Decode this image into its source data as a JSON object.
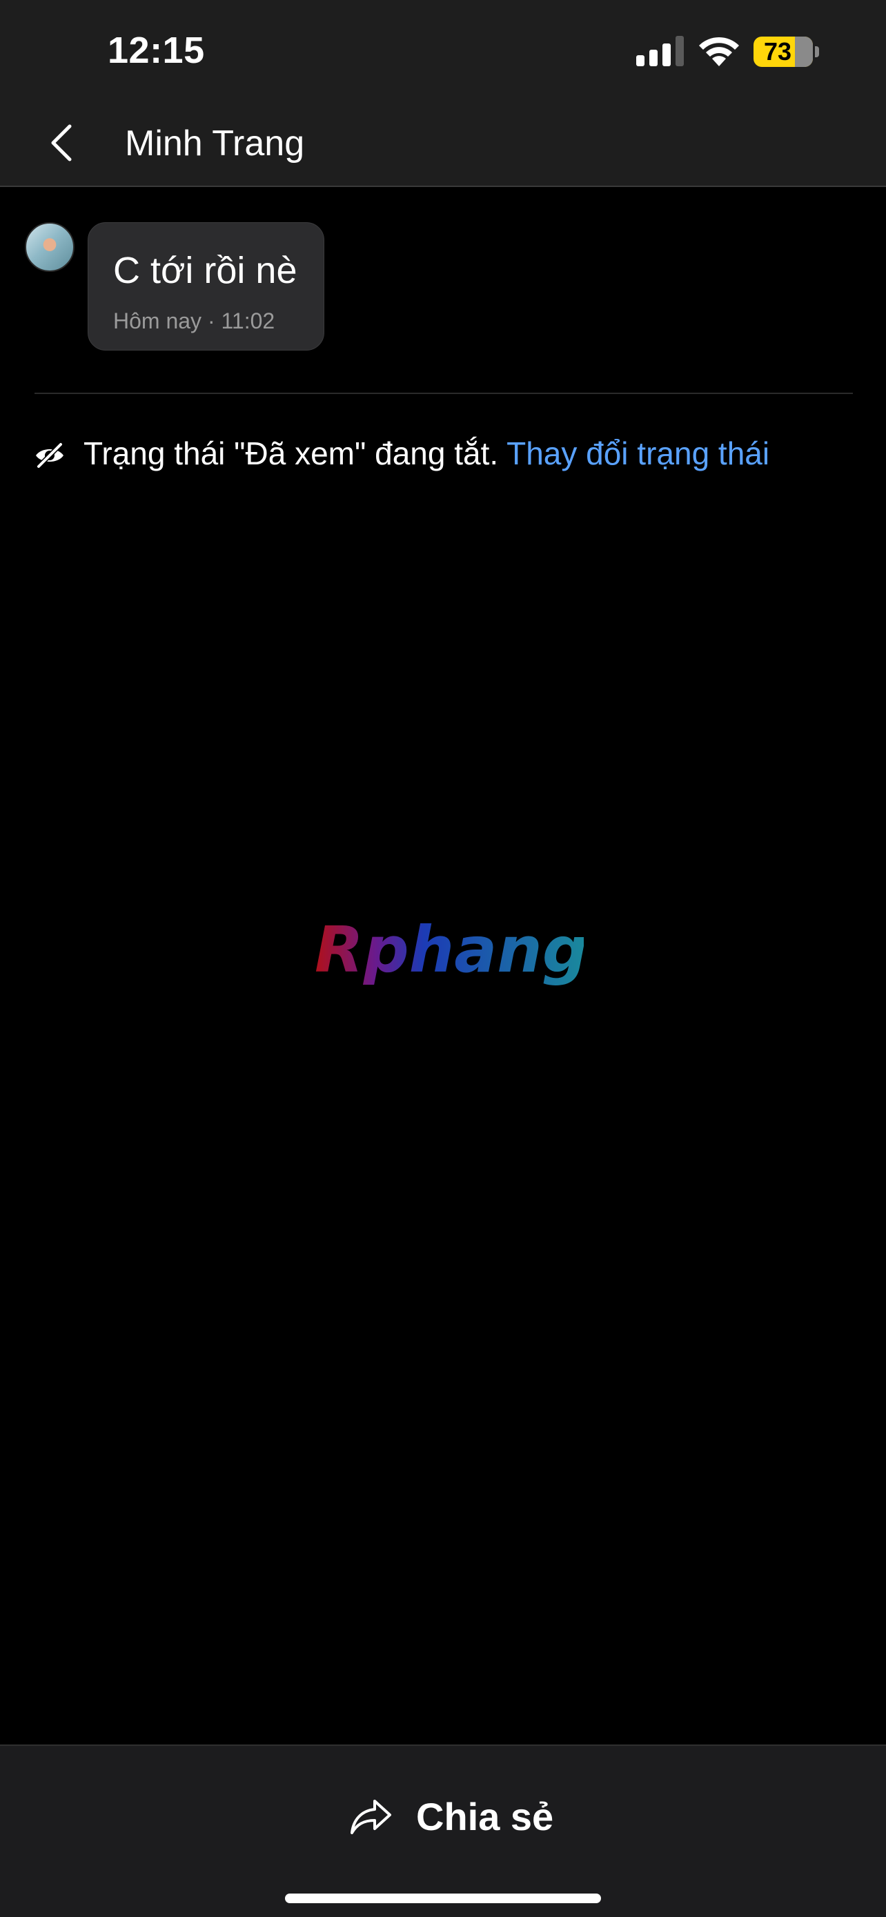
{
  "status_bar": {
    "time": "12:15",
    "battery_level": "73",
    "icons": [
      "signal-icon",
      "wifi-icon",
      "battery-icon"
    ]
  },
  "header": {
    "back_icon": "chevron-left-icon",
    "title": "Minh Trang"
  },
  "messages": [
    {
      "text": "C tới rồi nè",
      "timestamp": "Hôm nay · 11:02",
      "avatar": "avatar"
    }
  ],
  "seen_status": {
    "icon": "eye-slash-icon",
    "text": "Trạng thái \"Đã xem\" đang tắt. ",
    "link": "Thay đổi trạng thái"
  },
  "watermark": {
    "text": "Rphang"
  },
  "bottom_bar": {
    "share_icon": "share-arrow-icon",
    "share_label": "Chia sẻ"
  },
  "colors": {
    "background": "#000000",
    "bar": "#1e1e1e",
    "bubble": "#2c2c2e",
    "link": "#5aa2ff",
    "battery": "#ffd60a"
  }
}
